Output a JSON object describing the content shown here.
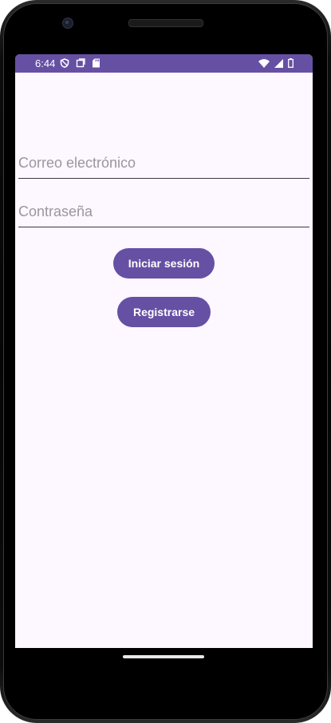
{
  "status_bar": {
    "time": "6:44",
    "background": "#6650a4",
    "left_icons": [
      "shield-icon",
      "screen-record-icon",
      "sd-card-icon"
    ],
    "right_icons": [
      "wifi-icon",
      "cell-signal-icon",
      "battery-icon"
    ]
  },
  "form": {
    "email_placeholder": "Correo electrónico",
    "email_value": "",
    "password_placeholder": "Contraseña",
    "password_value": ""
  },
  "buttons": {
    "login_label": "Iniciar sesión",
    "register_label": "Registrarse"
  },
  "theme": {
    "primary": "#6650a4",
    "surface": "#fdf7ff"
  }
}
